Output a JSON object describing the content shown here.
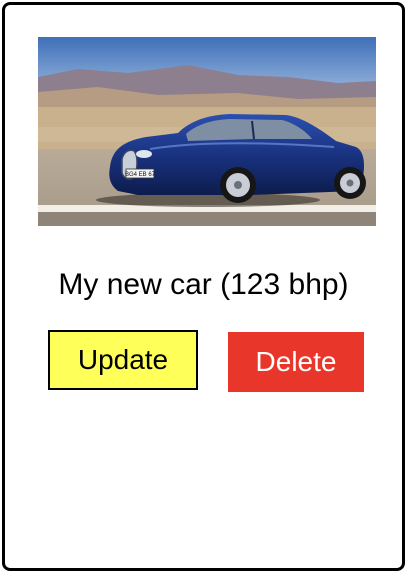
{
  "card": {
    "image_alt": "Blue sports car on a desert road",
    "plate_text": "BG4 EB 67",
    "title": "My new car (123 bhp)",
    "update_label": "Update",
    "delete_label": "Delete"
  },
  "colors": {
    "update_bg": "#ffff5a",
    "delete_bg": "#e8372a",
    "car_body": "#1d3a8a",
    "border": "#000000"
  }
}
